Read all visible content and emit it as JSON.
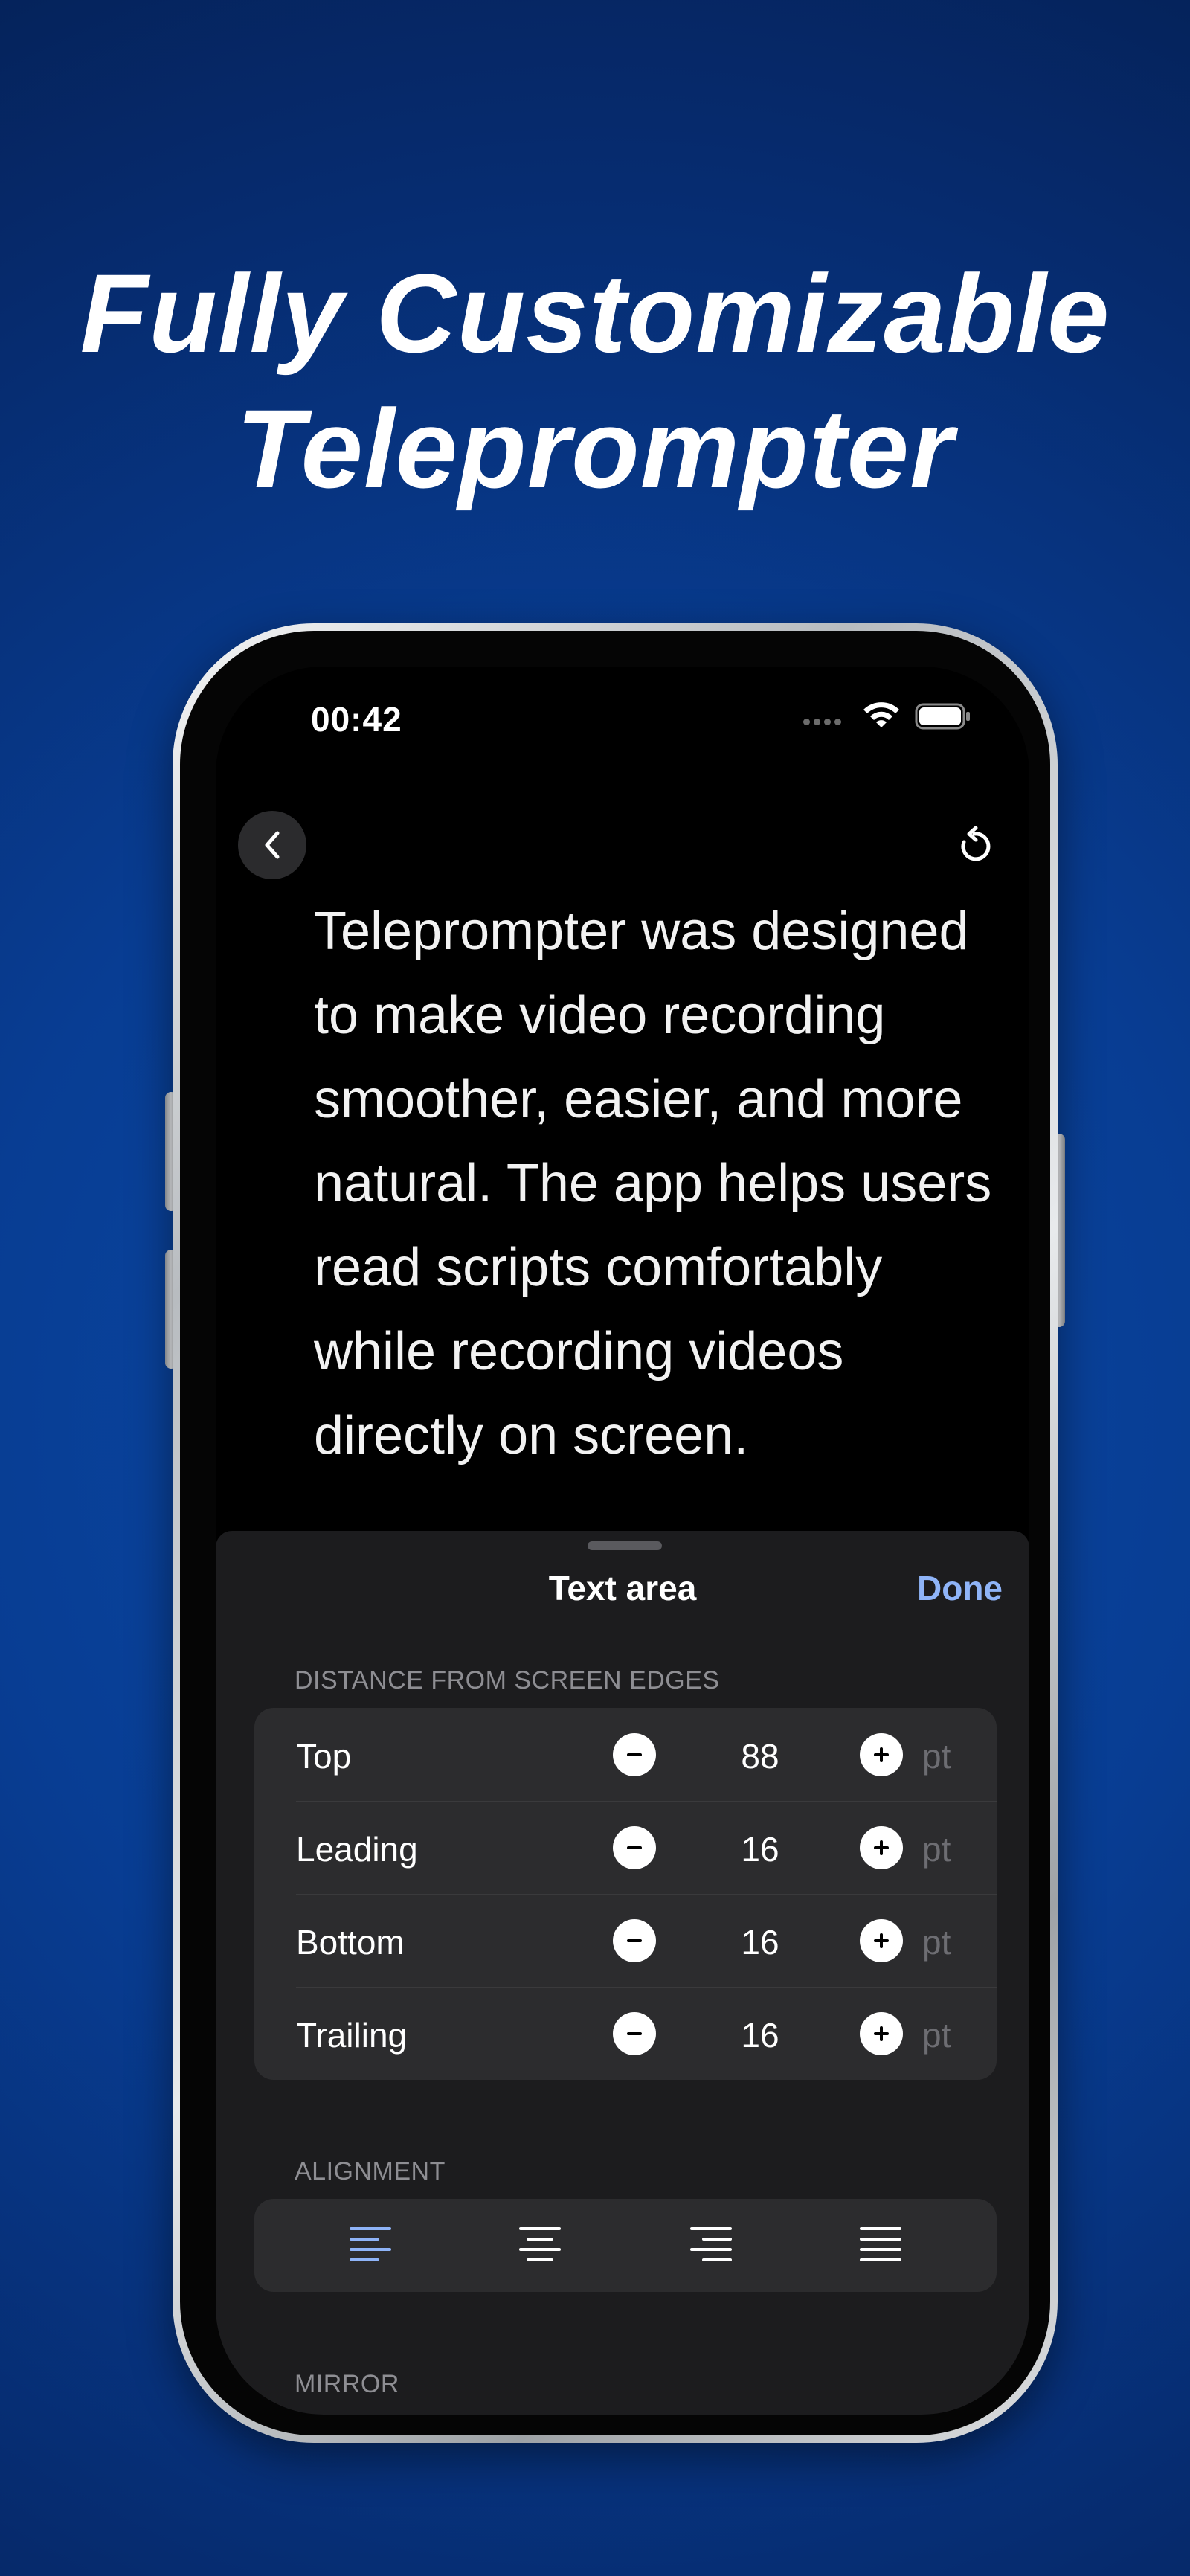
{
  "headline": {
    "line1": "Fully Customizable",
    "line2": "Teleprompter"
  },
  "status_bar": {
    "time": "00:42"
  },
  "script": {
    "text": "Teleprompter was designed to make video recording smoother, easier, and more natural. The app helps users read scripts comfortably while recording videos directly on screen."
  },
  "sheet": {
    "title": "Text area",
    "done_label": "Done",
    "distance_section": {
      "label": "DISTANCE FROM SCREEN EDGES",
      "rows": [
        {
          "label": "Top",
          "value": "88",
          "unit": "pt"
        },
        {
          "label": "Leading",
          "value": "16",
          "unit": "pt"
        },
        {
          "label": "Bottom",
          "value": "16",
          "unit": "pt"
        },
        {
          "label": "Trailing",
          "value": "16",
          "unit": "pt"
        }
      ]
    },
    "alignment_section": {
      "label": "ALIGNMENT",
      "options": [
        "align-left",
        "align-center",
        "align-right",
        "align-justify"
      ],
      "selected": "align-left"
    },
    "mirror_section": {
      "label": "MIRROR"
    }
  },
  "colors": {
    "accent": "#8fb4f8",
    "sheet_background": "#1c1c1e",
    "group_background": "#2c2c2e",
    "secondary_text": "#8e8e93",
    "background_blue": "#083d93"
  },
  "icons": {
    "back": "chevron-left-icon",
    "reset": "rotate-ccw-icon",
    "minus": "minus-circle-icon",
    "plus": "plus-circle-icon",
    "wifi": "wifi-icon",
    "battery": "battery-icon"
  }
}
